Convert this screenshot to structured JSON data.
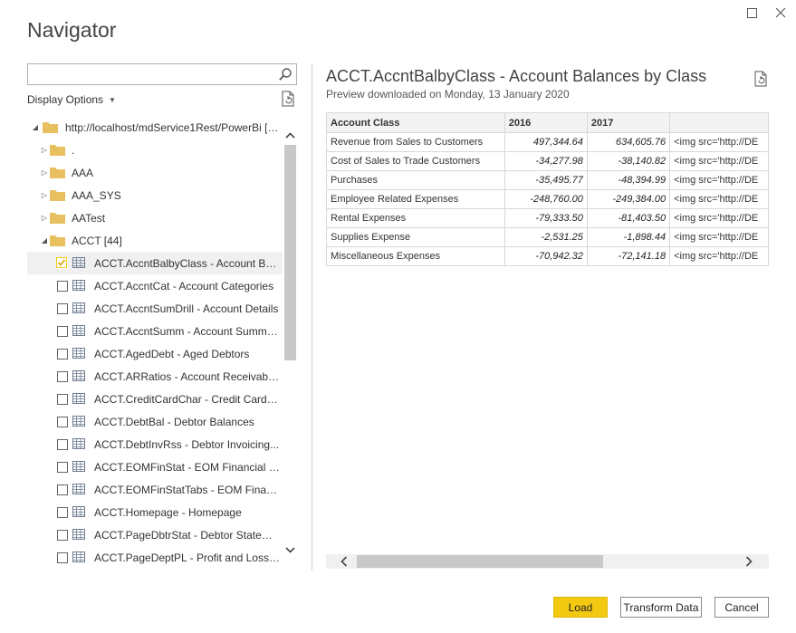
{
  "window": {
    "title": "Navigator"
  },
  "search": {
    "value": "",
    "placeholder": ""
  },
  "display_options": {
    "label": "Display Options"
  },
  "tree": {
    "root": {
      "label": "http://localhost/mdService1Rest/PowerBi [3..."
    },
    "folders": [
      {
        "label": "."
      },
      {
        "label": "AAA"
      },
      {
        "label": "AAA_SYS"
      },
      {
        "label": "AATest"
      },
      {
        "label": "ACCT [44]"
      }
    ],
    "items": [
      {
        "label": "ACCT.AccntBalbyClass - Account Bala...",
        "checked": true
      },
      {
        "label": "ACCT.AccntCat - Account Categories",
        "checked": false
      },
      {
        "label": "ACCT.AccntSumDrill - Account Details",
        "checked": false
      },
      {
        "label": "ACCT.AccntSumm - Account Summary",
        "checked": false
      },
      {
        "label": "ACCT.AgedDebt - Aged Debtors",
        "checked": false
      },
      {
        "label": "ACCT.ARRatios - Account Receivable...",
        "checked": false
      },
      {
        "label": "ACCT.CreditCardChar - Credit Card C...",
        "checked": false
      },
      {
        "label": "ACCT.DebtBal - Debtor Balances",
        "checked": false
      },
      {
        "label": "ACCT.DebtInvRss - Debtor Invoicing...",
        "checked": false
      },
      {
        "label": "ACCT.EOMFinStat - EOM Financial St...",
        "checked": false
      },
      {
        "label": "ACCT.EOMFinStatTabs - EOM Financi...",
        "checked": false
      },
      {
        "label": "ACCT.Homepage - Homepage",
        "checked": false
      },
      {
        "label": "ACCT.PageDbtrStat - Debtor Stateme...",
        "checked": false
      },
      {
        "label": "ACCT.PageDeptPL - Profit and Loss b...",
        "checked": false
      }
    ]
  },
  "preview": {
    "title": "ACCT.AccntBalbyClass - Account Balances by Class",
    "subtitle": "Preview downloaded on Monday, 13 January 2020",
    "columns": [
      "Account Class",
      "2016",
      "2017",
      ""
    ],
    "rows": [
      [
        "Revenue from Sales to Customers",
        "497,344.64",
        "634,605.76",
        "<img src='http://DE"
      ],
      [
        "Cost of Sales to Trade Customers",
        "-34,277.98",
        "-38,140.82",
        "<img src='http://DE"
      ],
      [
        "Purchases",
        "-35,495.77",
        "-48,394.99",
        "<img src='http://DE"
      ],
      [
        "Employee Related Expenses",
        "-248,760.00",
        "-249,384.00",
        "<img src='http://DE"
      ],
      [
        "Rental Expenses",
        "-79,333.50",
        "-81,403.50",
        "<img src='http://DE"
      ],
      [
        "Supplies Expense",
        "-2,531.25",
        "-1,898.44",
        "<img src='http://DE"
      ],
      [
        "Miscellaneous Expenses",
        "-70,942.32",
        "-72,141.18",
        "<img src='http://DE"
      ]
    ]
  },
  "buttons": {
    "load": "Load",
    "transform": "Transform Data",
    "cancel": "Cancel"
  },
  "colors": {
    "accent": "#f2c811",
    "folder": "#e8c060"
  },
  "icons": {
    "maximize": "maximize-icon",
    "close": "close-icon",
    "search": "search-icon",
    "refresh": "refresh-icon",
    "folder": "folder-icon",
    "table": "table-icon"
  }
}
